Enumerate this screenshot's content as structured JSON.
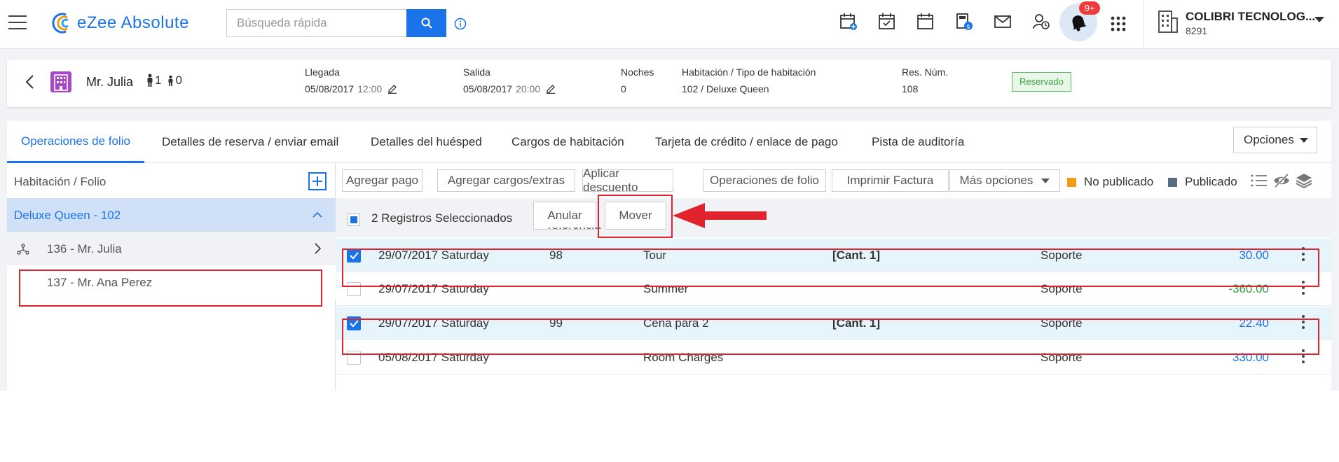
{
  "header": {
    "app_name": "eZee Absolute",
    "search_placeholder": "Búsqueda rápida",
    "notification_count": "9+",
    "company_name": "COLIBRI TECNOLOG...",
    "company_code": "8291"
  },
  "guest": {
    "name": "Mr. Julia",
    "adults": "1",
    "children": "0",
    "arrival_label": "Llegada",
    "arrival_date": "05/08/2017",
    "arrival_time": "12:00",
    "departure_label": "Salida",
    "departure_date": "05/08/2017",
    "departure_time": "20:00",
    "nights_label": "Noches",
    "nights": "0",
    "room_label": "Habitación / Tipo de habitación",
    "room_value": "102 / Deluxe Queen",
    "res_label": "Res. Núm.",
    "res_value": "108",
    "status": "Reservado"
  },
  "tabs": [
    {
      "label": "Operaciones de folio"
    },
    {
      "label": "Detalles de reserva / enviar email"
    },
    {
      "label": "Detalles del huésped"
    },
    {
      "label": "Cargos de habitación"
    },
    {
      "label": "Tarjeta de crédito / enlace de pago"
    },
    {
      "label": "Pista de auditoría"
    }
  ],
  "options_label": "Opciones",
  "left_panel": {
    "header": "Habitación / Folio",
    "room": "Deluxe Queen - 102",
    "folios": [
      {
        "label": "136 - Mr. Julia"
      },
      {
        "label": "137 - Mr. Ana Perez"
      }
    ]
  },
  "toolbar": {
    "add_payment": "Agregar pago",
    "add_charges": "Agregar cargos/extras",
    "apply_discount": "Aplicar descuento",
    "folio_ops": "Operaciones de folio",
    "print_invoice": "Imprimir Factura",
    "more_options": "Más opciones",
    "legend_unposted": "No publicado",
    "legend_posted": "Publicado"
  },
  "selection": {
    "text": "2 Registros Seleccionados",
    "void": "Anular",
    "move": "Mover",
    "ref_header": "referencia"
  },
  "rows": [
    {
      "date": "29/07/2017 Saturday",
      "ref": "98",
      "desc": "Tour",
      "qty": "[Cant. 1]",
      "user": "Soporte",
      "amount": "30.00",
      "checked": true
    },
    {
      "date": "29/07/2017 Saturday",
      "ref": "",
      "desc": "Summer",
      "qty": "",
      "user": "Soporte",
      "amount": "-360.00",
      "checked": false
    },
    {
      "date": "29/07/2017 Saturday",
      "ref": "99",
      "desc": "Cena para 2",
      "qty": "[Cant. 1]",
      "user": "Soporte",
      "amount": "22.40",
      "checked": true
    },
    {
      "date": "05/08/2017 Saturday",
      "ref": "",
      "desc": "Room Charges",
      "qty": "",
      "user": "Soporte",
      "amount": "330.00",
      "checked": false
    }
  ],
  "colors": {
    "accent": "#1a73e8",
    "highlight": "#e0232d",
    "unposted": "#f39c12",
    "posted": "#5a6b85",
    "status_green": "#3aa343"
  }
}
